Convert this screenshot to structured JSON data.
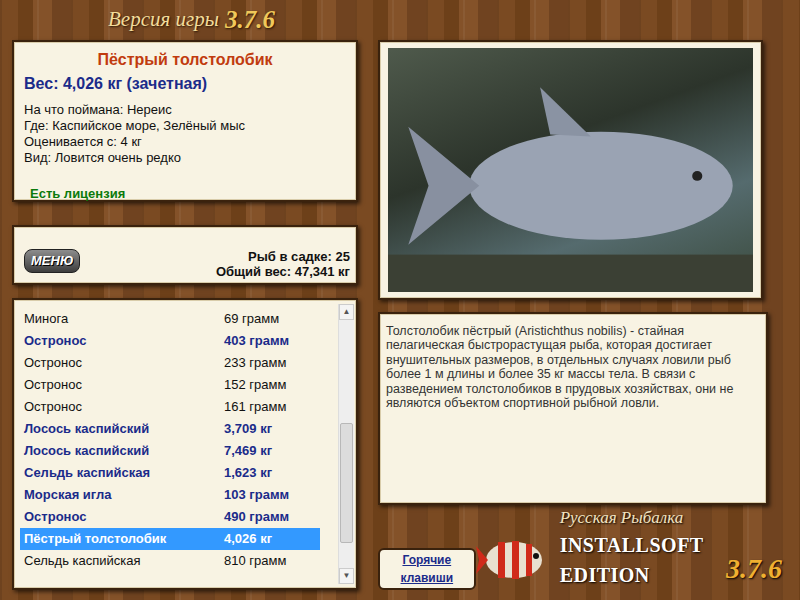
{
  "window": {
    "title": "Версия игры",
    "version": "3.7.6"
  },
  "fish": {
    "name": "Пёстрый толстолобик",
    "weight": "Вес: 4,026 кг (зачетная)",
    "lines": [
      "На что поймана: Нереис",
      "Где: Каспийское море, Зелёный мыс",
      "Оценивается с: 4 кг",
      "Вид: Ловится очень редко"
    ],
    "license": "Есть лицензия"
  },
  "menu_button": "МЕНЮ",
  "cage": {
    "count": "Рыб в садке: 25",
    "total": "Общий вес: 47,341 кг"
  },
  "catch_list": [
    {
      "name": "Минога",
      "weight": "69 грамм",
      "counted": false,
      "selected": false
    },
    {
      "name": "Остронос",
      "weight": "403 грамм",
      "counted": true,
      "selected": false
    },
    {
      "name": "Остронос",
      "weight": "233 грамм",
      "counted": false,
      "selected": false
    },
    {
      "name": "Остронос",
      "weight": "152 грамм",
      "counted": false,
      "selected": false
    },
    {
      "name": "Остронос",
      "weight": "161 грамм",
      "counted": false,
      "selected": false
    },
    {
      "name": "Лосось каспийский",
      "weight": "3,709 кг",
      "counted": true,
      "selected": false
    },
    {
      "name": "Лосось каспийский",
      "weight": "7,469 кг",
      "counted": true,
      "selected": false
    },
    {
      "name": "Сельдь каспийская",
      "weight": "1,623 кг",
      "counted": true,
      "selected": false
    },
    {
      "name": "Морская игла",
      "weight": "103 грамм",
      "counted": true,
      "selected": false
    },
    {
      "name": "Остронос",
      "weight": "490 грамм",
      "counted": true,
      "selected": false
    },
    {
      "name": "Пёстрый толстолобик",
      "weight": "4,026 кг",
      "counted": true,
      "selected": true
    },
    {
      "name": "Сельдь каспийская",
      "weight": "810 грамм",
      "counted": false,
      "selected": false
    }
  ],
  "scrollbar": {
    "up": "▲",
    "down": "▼",
    "level": 0.82
  },
  "description": "Толстолобик пёстрый (Aristichthus nobilis) - стайная пелагическая быстрорастущая рыба, которая достигает внушительных размеров, в отдельных случаях ловили рыб более 1 м длины и более 35 кг массы тела. В связи с разведением толстолобиков в прудовых хозяйствах, они не являются объектом спортивной рыбной ловли.",
  "hotkeys_button": "Горячие клавиши",
  "logo": {
    "line1": "Русская Рыбалка",
    "line2": "INSTALLSOFT EDITION",
    "version": "3.7.6"
  }
}
